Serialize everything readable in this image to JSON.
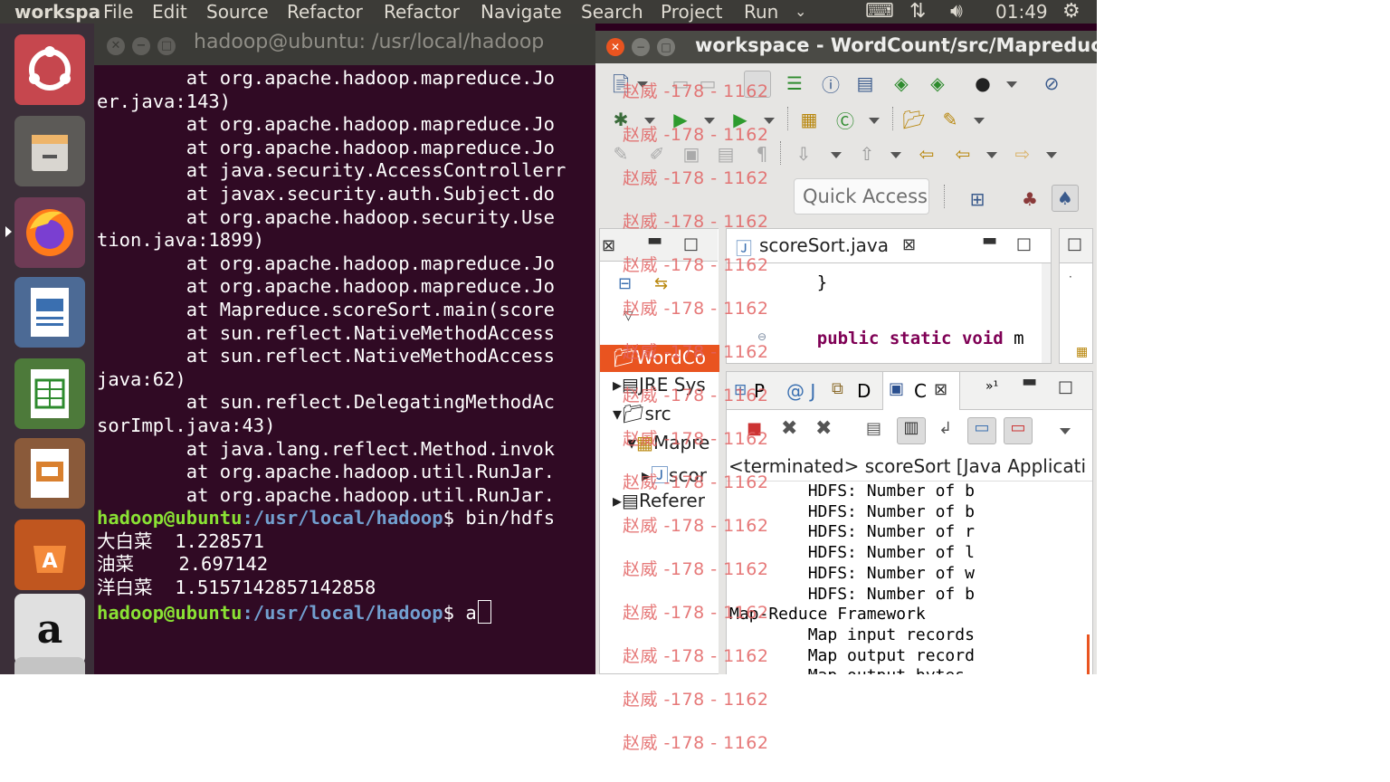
{
  "top_panel": {
    "app_name": "workspa",
    "menus": [
      "File",
      "Edit",
      "Source",
      "Refactor",
      "Refactor",
      "Navigate",
      "Search",
      "Project",
      "Run"
    ],
    "time": "01:49"
  },
  "launcher": {
    "items": [
      "ubuntu-dash",
      "files",
      "firefox",
      "libreoffice-writer",
      "libreoffice-calc",
      "libreoffice-impress",
      "software-center",
      "amazon",
      "system-updates"
    ]
  },
  "terminal": {
    "title": "hadoop@ubuntu: /usr/local/hadoop",
    "lines": [
      "        at org.apache.hadoop.mapreduce.Jo",
      "er.java:143)",
      "        at org.apache.hadoop.mapreduce.Jo",
      "        at org.apache.hadoop.mapreduce.Jo",
      "        at java.security.AccessControllerr",
      "        at javax.security.auth.Subject.do",
      "        at org.apache.hadoop.security.Use",
      "tion.java:1899)",
      "        at org.apache.hadoop.mapreduce.Jo",
      "        at org.apache.hadoop.mapreduce.Jo",
      "        at Mapreduce.scoreSort.main(score",
      "        at sun.reflect.NativeMethodAccess",
      "        at sun.reflect.NativeMethodAccess",
      "java:62)",
      "        at sun.reflect.DelegatingMethodAc",
      "sorImpl.java:43)",
      "        at java.lang.reflect.Method.invok",
      "        at org.apache.hadoop.util.RunJar.",
      "        at org.apache.hadoop.util.RunJar."
    ],
    "prompt_user": "hadoop@ubuntu",
    "prompt_path": ":/usr/local/hadoop",
    "prompt_sym": "$ ",
    "command1": "bin/hdfs",
    "results": [
      {
        "name": "大白菜",
        "value": "1.228571"
      },
      {
        "name": "油菜",
        "value": "2.697142"
      },
      {
        "name": "洋白菜",
        "value": "1.5157142857142858"
      }
    ],
    "command2": "a"
  },
  "eclipse": {
    "title": "workspace - WordCount/src/Mapreduce",
    "quick_access": "Quick Access",
    "editor_tab": "scoreSort.java",
    "code_lines": [
      "    }",
      "",
      "    public static void m"
    ],
    "code_keywords": [
      "public",
      "static",
      "void"
    ],
    "explorer_tree": [
      "WordCo",
      "JRE Sys",
      "src",
      "Mapre",
      "scor",
      "Referer"
    ],
    "bottom_tabs": [
      "P",
      "@ J",
      "D",
      "C"
    ],
    "console_header": "<terminated> scoreSort [Java Applicati",
    "console_lines": [
      "        HDFS: Number of b",
      "        HDFS: Number of b",
      "        HDFS: Number of r",
      "        HDFS: Number of l",
      "        HDFS: Number of w",
      "        HDFS: Number of b",
      "Map-Reduce Framework",
      "        Map input records",
      "        Map output record",
      "        Map output bytes"
    ]
  },
  "watermark": "赵威 -178 - 1162"
}
